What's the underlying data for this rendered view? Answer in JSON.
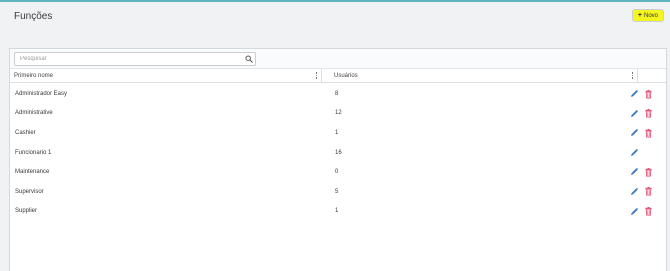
{
  "page": {
    "title": "Funções"
  },
  "toolbar": {
    "new_label": "Novo"
  },
  "search": {
    "placeholder": "Pesquisar",
    "value": ""
  },
  "table": {
    "columns": {
      "name": "Primeiro nome",
      "users": "Usuários"
    },
    "rows": [
      {
        "name": "Administrador Easy",
        "users": "8",
        "deletable": true
      },
      {
        "name": "Administrative",
        "users": "12",
        "deletable": true
      },
      {
        "name": "Cashier",
        "users": "1",
        "deletable": true
      },
      {
        "name": "Funcionario 1",
        "users": "16",
        "deletable": false
      },
      {
        "name": "Maintenance",
        "users": "0",
        "deletable": true
      },
      {
        "name": "Supervisor",
        "users": "5",
        "deletable": true
      },
      {
        "name": "Supplier",
        "users": "1",
        "deletable": true
      }
    ]
  },
  "icons": {
    "edit": "pencil-icon",
    "delete": "trash-icon",
    "search": "search-icon",
    "add": "plus-icon",
    "column_menu": "kebab-icon"
  },
  "colors": {
    "accent_top": "#5fb3bf",
    "new_button": "#f5f520",
    "edit_icon": "#3a7bbf",
    "delete_icon": "#e0436b"
  }
}
